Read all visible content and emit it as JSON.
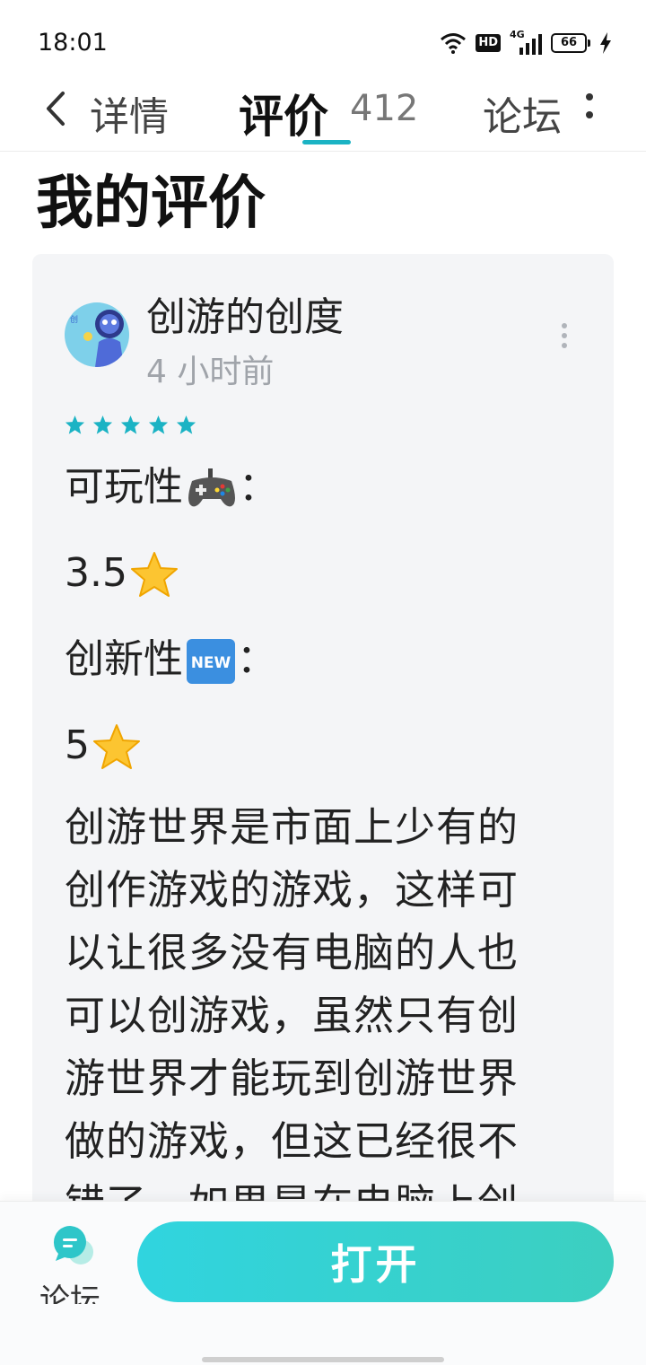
{
  "status_bar": {
    "time": "18:01",
    "network": "4G",
    "hd_badge": "HD",
    "battery": "66"
  },
  "tabs": {
    "details": "详情",
    "reviews": "评价",
    "review_count": "412",
    "forum": "论坛"
  },
  "section_title": "我的评价",
  "review": {
    "username": "创游的创度",
    "time_ago": "4 小时前",
    "star_rating": 5,
    "star_color": "#1bb3c4",
    "lines": [
      {
        "text": "可玩性",
        "icon": "gamepad-icon",
        "suffix": "："
      },
      {
        "text": "3.5",
        "icon": "star-emoji-icon",
        "suffix": ""
      },
      {
        "text": "创新性",
        "icon": "new-badge-icon",
        "suffix": "："
      },
      {
        "text": "5",
        "icon": "star-emoji-icon",
        "suffix": ""
      }
    ],
    "new_badge_text": "NEW",
    "body_lines": [
      "创游世界是市面上少有的",
      "创作游戏的游戏，这样可",
      "以让很多没有电脑的人也",
      "可以创游戏，虽然只有创",
      "游世界才能玩到创游世界",
      "做的游戏，但这已经很不",
      "错了，如果是在电脑上创"
    ]
  },
  "bottom_bar": {
    "forum_label": "论坛",
    "open_button": "打开",
    "accent_color": "#30d4df"
  }
}
